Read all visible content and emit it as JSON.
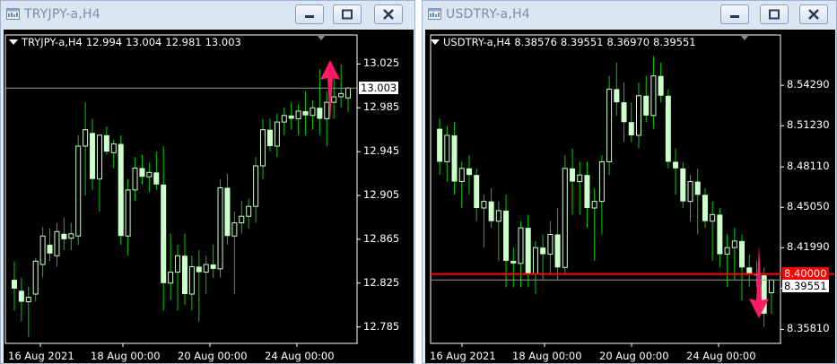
{
  "windows": [
    {
      "id": "tryjpy",
      "title": "TRYJPY-a,H4",
      "ohlc": {
        "symbol": "TRYJPY-a,H4",
        "open": "12.994",
        "high": "13.004",
        "low": "12.981",
        "close": "13.003"
      },
      "price_labels": [
        "13.025",
        "12.985",
        "12.945",
        "12.905",
        "12.865",
        "12.825",
        "12.785"
      ],
      "current_price_tag": "13.003",
      "time_labels": [
        "16 Aug 2021",
        "18 Aug 00:00",
        "20 Aug 00:00",
        "24 Aug 00:00"
      ],
      "arrow": {
        "direction": "up",
        "color": "#ff1a66"
      }
    },
    {
      "id": "usdtry",
      "title": "USDTRY-a,H4",
      "ohlc": {
        "symbol": "USDTRY-a,H4",
        "open": "8.38576",
        "high": "8.39551",
        "low": "8.36970",
        "close": "8.39551"
      },
      "price_labels": [
        "8.54290",
        "8.51230",
        "8.48110",
        "8.45050",
        "8.41990",
        "8.38930",
        "8.35810"
      ],
      "level_tag": "8.40000",
      "current_price_tag": "8.39551",
      "time_labels": [
        "16 Aug 2021",
        "18 Aug 00:00",
        "20 Aug 00:00",
        "24 Aug 00:00"
      ],
      "arrow": {
        "direction": "down",
        "color": "#ff1a66"
      }
    }
  ],
  "colors": {
    "background": "#000000",
    "candle": "#ccffcc",
    "wick": "#00cc00",
    "level_line": "#ff0000",
    "arrow": "#ff1a66"
  },
  "chart_data": [
    {
      "type": "candlestick",
      "symbol": "TRYJPY-a,H4",
      "ylim": [
        12.77,
        13.04
      ],
      "y_ticks": [
        13.025,
        12.985,
        12.945,
        12.905,
        12.865,
        12.825,
        12.785
      ],
      "current_price": 13.003,
      "candles": [
        {
          "o": 12.828,
          "h": 12.845,
          "l": 12.8,
          "c": 12.82
        },
        {
          "o": 12.818,
          "h": 12.83,
          "l": 12.79,
          "c": 12.808
        },
        {
          "o": 12.808,
          "h": 12.822,
          "l": 12.776,
          "c": 12.812
        },
        {
          "o": 12.815,
          "h": 12.848,
          "l": 12.808,
          "c": 12.845
        },
        {
          "o": 12.842,
          "h": 12.876,
          "l": 12.83,
          "c": 12.868
        },
        {
          "o": 12.86,
          "h": 12.875,
          "l": 12.845,
          "c": 12.852
        },
        {
          "o": 12.85,
          "h": 12.88,
          "l": 12.84,
          "c": 12.872
        },
        {
          "o": 12.87,
          "h": 12.885,
          "l": 12.855,
          "c": 12.865
        },
        {
          "o": 12.866,
          "h": 12.88,
          "l": 12.855,
          "c": 12.87
        },
        {
          "o": 12.868,
          "h": 12.96,
          "l": 12.86,
          "c": 12.95
        },
        {
          "o": 12.95,
          "h": 12.99,
          "l": 12.905,
          "c": 12.965
        },
        {
          "o": 12.962,
          "h": 12.975,
          "l": 12.91,
          "c": 12.92
        },
        {
          "o": 12.92,
          "h": 12.96,
          "l": 12.89,
          "c": 12.96
        },
        {
          "o": 12.96,
          "h": 12.968,
          "l": 12.942,
          "c": 12.945
        },
        {
          "o": 12.944,
          "h": 12.956,
          "l": 12.93,
          "c": 12.952
        },
        {
          "o": 12.952,
          "h": 12.96,
          "l": 12.86,
          "c": 12.868
        },
        {
          "o": 12.868,
          "h": 12.92,
          "l": 12.85,
          "c": 12.91
        },
        {
          "o": 12.91,
          "h": 12.94,
          "l": 12.9,
          "c": 12.93
        },
        {
          "o": 12.93,
          "h": 12.942,
          "l": 12.915,
          "c": 12.922
        },
        {
          "o": 12.922,
          "h": 12.935,
          "l": 12.908,
          "c": 12.926
        },
        {
          "o": 12.926,
          "h": 12.945,
          "l": 12.91,
          "c": 12.915
        },
        {
          "o": 12.915,
          "h": 12.95,
          "l": 12.8,
          "c": 12.825
        },
        {
          "o": 12.825,
          "h": 12.87,
          "l": 12.81,
          "c": 12.835
        },
        {
          "o": 12.835,
          "h": 12.86,
          "l": 12.8,
          "c": 12.85
        },
        {
          "o": 12.85,
          "h": 12.87,
          "l": 12.805,
          "c": 12.815
        },
        {
          "o": 12.815,
          "h": 12.85,
          "l": 12.8,
          "c": 12.84
        },
        {
          "o": 12.84,
          "h": 12.855,
          "l": 12.79,
          "c": 12.835
        },
        {
          "o": 12.835,
          "h": 12.85,
          "l": 12.815,
          "c": 12.842
        },
        {
          "o": 12.842,
          "h": 12.86,
          "l": 12.83,
          "c": 12.838
        },
        {
          "o": 12.838,
          "h": 12.92,
          "l": 12.83,
          "c": 12.912
        },
        {
          "o": 12.912,
          "h": 12.925,
          "l": 12.86,
          "c": 12.868
        },
        {
          "o": 12.868,
          "h": 12.89,
          "l": 12.815,
          "c": 12.88
        },
        {
          "o": 12.88,
          "h": 12.9,
          "l": 12.87,
          "c": 12.886
        },
        {
          "o": 12.886,
          "h": 12.902,
          "l": 12.875,
          "c": 12.895
        },
        {
          "o": 12.895,
          "h": 12.94,
          "l": 12.88,
          "c": 12.932
        },
        {
          "o": 12.932,
          "h": 12.975,
          "l": 12.92,
          "c": 12.965
        },
        {
          "o": 12.965,
          "h": 12.975,
          "l": 12.945,
          "c": 12.95
        },
        {
          "o": 12.95,
          "h": 12.98,
          "l": 12.94,
          "c": 12.972
        },
        {
          "o": 12.972,
          "h": 12.985,
          "l": 12.96,
          "c": 12.978
        },
        {
          "o": 12.978,
          "h": 12.99,
          "l": 12.965,
          "c": 12.975
        },
        {
          "o": 12.975,
          "h": 12.988,
          "l": 12.96,
          "c": 12.982
        },
        {
          "o": 12.982,
          "h": 13.0,
          "l": 12.96,
          "c": 12.978
        },
        {
          "o": 12.978,
          "h": 12.992,
          "l": 12.965,
          "c": 12.985
        },
        {
          "o": 12.985,
          "h": 13.02,
          "l": 12.96,
          "c": 12.975
        },
        {
          "o": 12.975,
          "h": 13.0,
          "l": 12.95,
          "c": 12.99
        },
        {
          "o": 12.99,
          "h": 13.018,
          "l": 12.975,
          "c": 12.995
        },
        {
          "o": 12.995,
          "h": 13.025,
          "l": 12.985,
          "c": 12.998
        },
        {
          "o": 12.994,
          "h": 13.004,
          "l": 12.981,
          "c": 13.003
        }
      ]
    },
    {
      "type": "candlestick",
      "symbol": "USDTRY-a,H4",
      "ylim": [
        8.3475,
        8.5715
      ],
      "y_ticks": [
        8.5429,
        8.5123,
        8.4811,
        8.4505,
        8.4199,
        8.3893,
        8.3581
      ],
      "level": 8.4,
      "current_price": 8.39551,
      "candles": [
        {
          "o": 8.51,
          "h": 8.518,
          "l": 8.475,
          "c": 8.485
        },
        {
          "o": 8.485,
          "h": 8.512,
          "l": 8.47,
          "c": 8.505
        },
        {
          "o": 8.505,
          "h": 8.515,
          "l": 8.46,
          "c": 8.47
        },
        {
          "o": 8.47,
          "h": 8.485,
          "l": 8.45,
          "c": 8.48
        },
        {
          "o": 8.48,
          "h": 8.49,
          "l": 8.46,
          "c": 8.475
        },
        {
          "o": 8.475,
          "h": 8.48,
          "l": 8.44,
          "c": 8.45
        },
        {
          "o": 8.45,
          "h": 8.46,
          "l": 8.42,
          "c": 8.455
        },
        {
          "o": 8.455,
          "h": 8.465,
          "l": 8.435,
          "c": 8.44
        },
        {
          "o": 8.44,
          "h": 8.455,
          "l": 8.41,
          "c": 8.448
        },
        {
          "o": 8.448,
          "h": 8.46,
          "l": 8.39,
          "c": 8.41
        },
        {
          "o": 8.41,
          "h": 8.42,
          "l": 8.39,
          "c": 8.408
        },
        {
          "o": 8.408,
          "h": 8.44,
          "l": 8.39,
          "c": 8.435
        },
        {
          "o": 8.435,
          "h": 8.445,
          "l": 8.39,
          "c": 8.4
        },
        {
          "o": 8.4,
          "h": 8.425,
          "l": 8.385,
          "c": 8.42
        },
        {
          "o": 8.42,
          "h": 8.43,
          "l": 8.395,
          "c": 8.415
        },
        {
          "o": 8.415,
          "h": 8.44,
          "l": 8.4,
          "c": 8.43
        },
        {
          "o": 8.43,
          "h": 8.45,
          "l": 8.395,
          "c": 8.405
        },
        {
          "o": 8.405,
          "h": 8.49,
          "l": 8.4,
          "c": 8.48
        },
        {
          "o": 8.48,
          "h": 8.495,
          "l": 8.445,
          "c": 8.47
        },
        {
          "o": 8.47,
          "h": 8.485,
          "l": 8.445,
          "c": 8.475
        },
        {
          "o": 8.475,
          "h": 8.485,
          "l": 8.435,
          "c": 8.45
        },
        {
          "o": 8.45,
          "h": 8.465,
          "l": 8.41,
          "c": 8.455
        },
        {
          "o": 8.455,
          "h": 8.49,
          "l": 8.43,
          "c": 8.485
        },
        {
          "o": 8.485,
          "h": 8.55,
          "l": 8.475,
          "c": 8.54
        },
        {
          "o": 8.54,
          "h": 8.56,
          "l": 8.52,
          "c": 8.53
        },
        {
          "o": 8.53,
          "h": 8.545,
          "l": 8.5,
          "c": 8.515
        },
        {
          "o": 8.515,
          "h": 8.53,
          "l": 8.5,
          "c": 8.505
        },
        {
          "o": 8.505,
          "h": 8.545,
          "l": 8.495,
          "c": 8.535
        },
        {
          "o": 8.535,
          "h": 8.55,
          "l": 8.515,
          "c": 8.52
        },
        {
          "o": 8.52,
          "h": 8.565,
          "l": 8.51,
          "c": 8.55
        },
        {
          "o": 8.55,
          "h": 8.56,
          "l": 8.53,
          "c": 8.535
        },
        {
          "o": 8.535,
          "h": 8.54,
          "l": 8.48,
          "c": 8.485
        },
        {
          "o": 8.485,
          "h": 8.495,
          "l": 8.46,
          "c": 8.48
        },
        {
          "o": 8.48,
          "h": 8.485,
          "l": 8.45,
          "c": 8.455
        },
        {
          "o": 8.455,
          "h": 8.475,
          "l": 8.44,
          "c": 8.47
        },
        {
          "o": 8.47,
          "h": 8.48,
          "l": 8.43,
          "c": 8.46
        },
        {
          "o": 8.46,
          "h": 8.465,
          "l": 8.435,
          "c": 8.44
        },
        {
          "o": 8.44,
          "h": 8.455,
          "l": 8.41,
          "c": 8.445
        },
        {
          "o": 8.445,
          "h": 8.45,
          "l": 8.405,
          "c": 8.415
        },
        {
          "o": 8.415,
          "h": 8.43,
          "l": 8.39,
          "c": 8.42
        },
        {
          "o": 8.42,
          "h": 8.435,
          "l": 8.395,
          "c": 8.425
        },
        {
          "o": 8.425,
          "h": 8.43,
          "l": 8.38,
          "c": 8.405
        },
        {
          "o": 8.405,
          "h": 8.415,
          "l": 8.39,
          "c": 8.4
        },
        {
          "o": 8.4,
          "h": 8.41,
          "l": 8.39,
          "c": 8.399
        },
        {
          "o": 8.399,
          "h": 8.405,
          "l": 8.36,
          "c": 8.37
        },
        {
          "o": 8.3858,
          "h": 8.3955,
          "l": 8.3697,
          "c": 8.3955
        }
      ]
    }
  ]
}
